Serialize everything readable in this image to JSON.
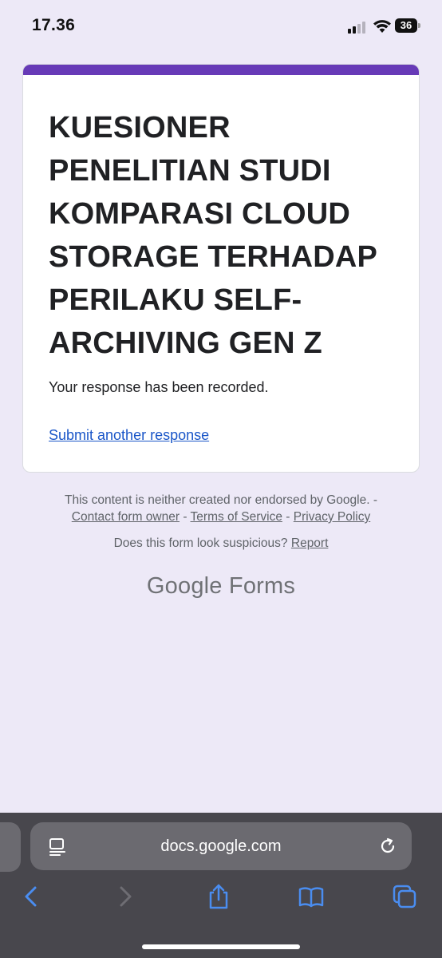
{
  "status_bar": {
    "time": "17.36",
    "battery": "36"
  },
  "form": {
    "accent_color": "#673ab7",
    "title": "KUESIONER PENELITIAN STUDI KOMPARASI CLOUD STORAGE TERHADAP PERILAKU SELF-ARCHIVING GEN Z",
    "confirmation": "Your response has been recorded.",
    "submit_another": "Submit another response"
  },
  "footer": {
    "disclaimer": "This content is neither created nor endorsed by Google. -",
    "contact_owner": "Contact form owner",
    "terms": "Terms of Service",
    "privacy": "Privacy Policy",
    "separator": "-",
    "suspicious_question": "Does this form look suspicious?",
    "report": "Report",
    "brand_google": "Google",
    "brand_forms": "Forms"
  },
  "browser": {
    "url": "docs.google.com",
    "icons": [
      "reader-mode-icon",
      "reload-icon",
      "back-icon",
      "forward-icon",
      "share-icon",
      "bookmarks-icon",
      "tabs-icon"
    ],
    "accent_color": "#4a8df0"
  }
}
